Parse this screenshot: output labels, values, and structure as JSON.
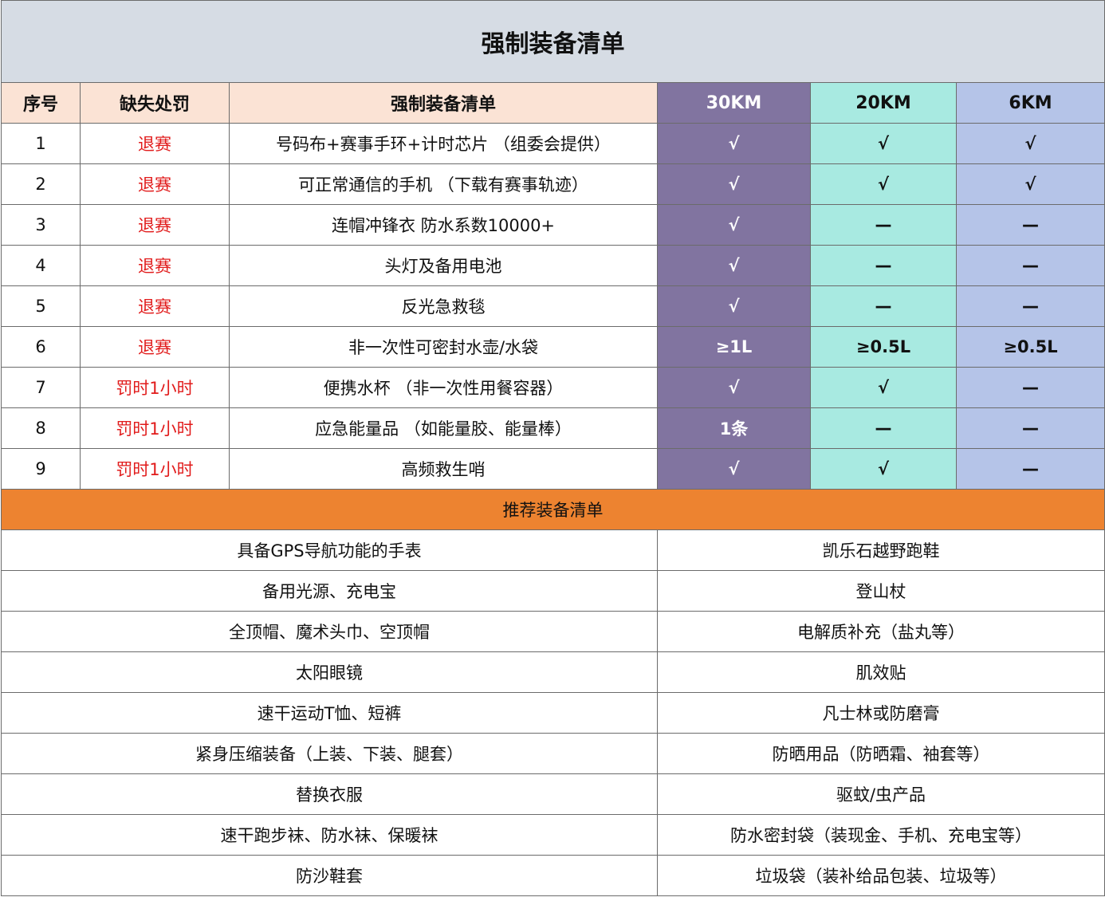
{
  "title": "强制装备清单",
  "headers": {
    "index": "序号",
    "penalty": "缺失处罚",
    "item": "强制装备清单",
    "km30": "30KM",
    "km20": "20KM",
    "km6": "6KM"
  },
  "mandatory_items": [
    {
      "index": "1",
      "penalty": "退赛",
      "item": "号码布+赛事手环+计时芯片 （组委会提供）",
      "km30": "√",
      "km20": "√",
      "km6": "√"
    },
    {
      "index": "2",
      "penalty": "退赛",
      "item": "可正常通信的手机 （下载有赛事轨迹）",
      "km30": "√",
      "km20": "√",
      "km6": "√"
    },
    {
      "index": "3",
      "penalty": "退赛",
      "item": "连帽冲锋衣 防水系数10000+",
      "km30": "√",
      "km20": "—",
      "km6": "—"
    },
    {
      "index": "4",
      "penalty": "退赛",
      "item": "头灯及备用电池",
      "km30": "√",
      "km20": "—",
      "km6": "—"
    },
    {
      "index": "5",
      "penalty": "退赛",
      "item": "反光急救毯",
      "km30": "√",
      "km20": "—",
      "km6": "—"
    },
    {
      "index": "6",
      "penalty": "退赛",
      "item": "非一次性可密封水壶/水袋",
      "km30": "≥1L",
      "km20": "≥0.5L",
      "km6": "≥0.5L"
    },
    {
      "index": "7",
      "penalty": "罚时1小时",
      "item": "便携水杯 （非一次性用餐容器）",
      "km30": "√",
      "km20": "√",
      "km6": "—"
    },
    {
      "index": "8",
      "penalty": "罚时1小时",
      "item": "应急能量品 （如能量胶、能量棒）",
      "km30": "1条",
      "km20": "—",
      "km6": "—"
    },
    {
      "index": "9",
      "penalty": "罚时1小时",
      "item": "高频救生哨",
      "km30": "√",
      "km20": "√",
      "km6": "—"
    }
  ],
  "recommended_title": "推荐装备清单",
  "recommended_items": [
    {
      "left": "具备GPS导航功能的手表",
      "right": "凯乐石越野跑鞋"
    },
    {
      "left": "备用光源、充电宝",
      "right": "登山杖"
    },
    {
      "left": "全顶帽、魔术头巾、空顶帽",
      "right": "电解质补充（盐丸等）"
    },
    {
      "left": "太阳眼镜",
      "right": "肌效贴"
    },
    {
      "left": "速干运动T恤、短裤",
      "right": "凡士林或防磨膏"
    },
    {
      "left": "紧身压缩装备（上装、下装、腿套）",
      "right": "防晒用品（防晒霜、袖套等）"
    },
    {
      "left": "替换衣服",
      "right": "驱蚊/虫产品"
    },
    {
      "left": "速干跑步袜、防水袜、保暖袜",
      "right": "防水密封袋（装现金、手机、充电宝等）"
    },
    {
      "left": "防沙鞋套",
      "right": "垃圾袋（装补给品包装、垃圾等）"
    }
  ]
}
